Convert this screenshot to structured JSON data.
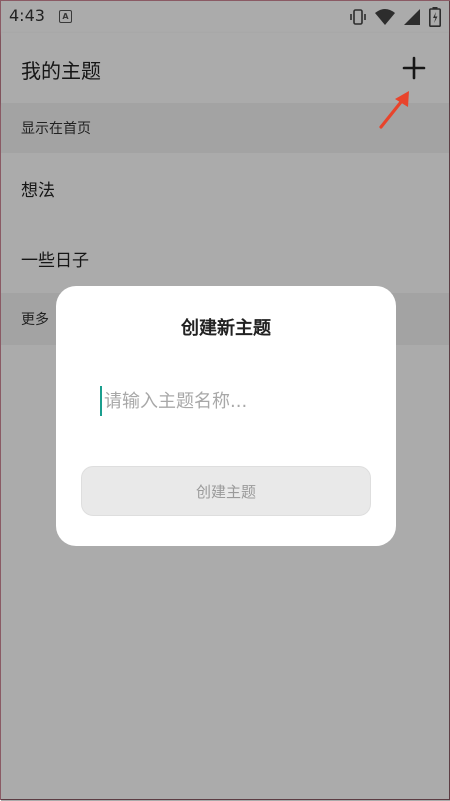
{
  "status_bar": {
    "time": "4:43",
    "notification_icon": "a-icon",
    "right_icons": [
      "vibrate-icon",
      "wifi-icon",
      "signal-icon",
      "battery-icon"
    ]
  },
  "app_bar": {
    "title": "我的主题",
    "add_icon": "plus-icon"
  },
  "list": {
    "section_home": "显示在首页",
    "items": [
      {
        "label": "想法"
      },
      {
        "label": "一些日子"
      }
    ],
    "section_more": "更多"
  },
  "dialog": {
    "title": "创建新主题",
    "input": {
      "value": "",
      "placeholder": "请输入主题名称..."
    },
    "create_button_label": "创建主题"
  },
  "colors": {
    "accent": "#1a9e8e",
    "annotation_arrow": "#e8442c",
    "overlay": "rgba(0,0,0,0.33)"
  }
}
